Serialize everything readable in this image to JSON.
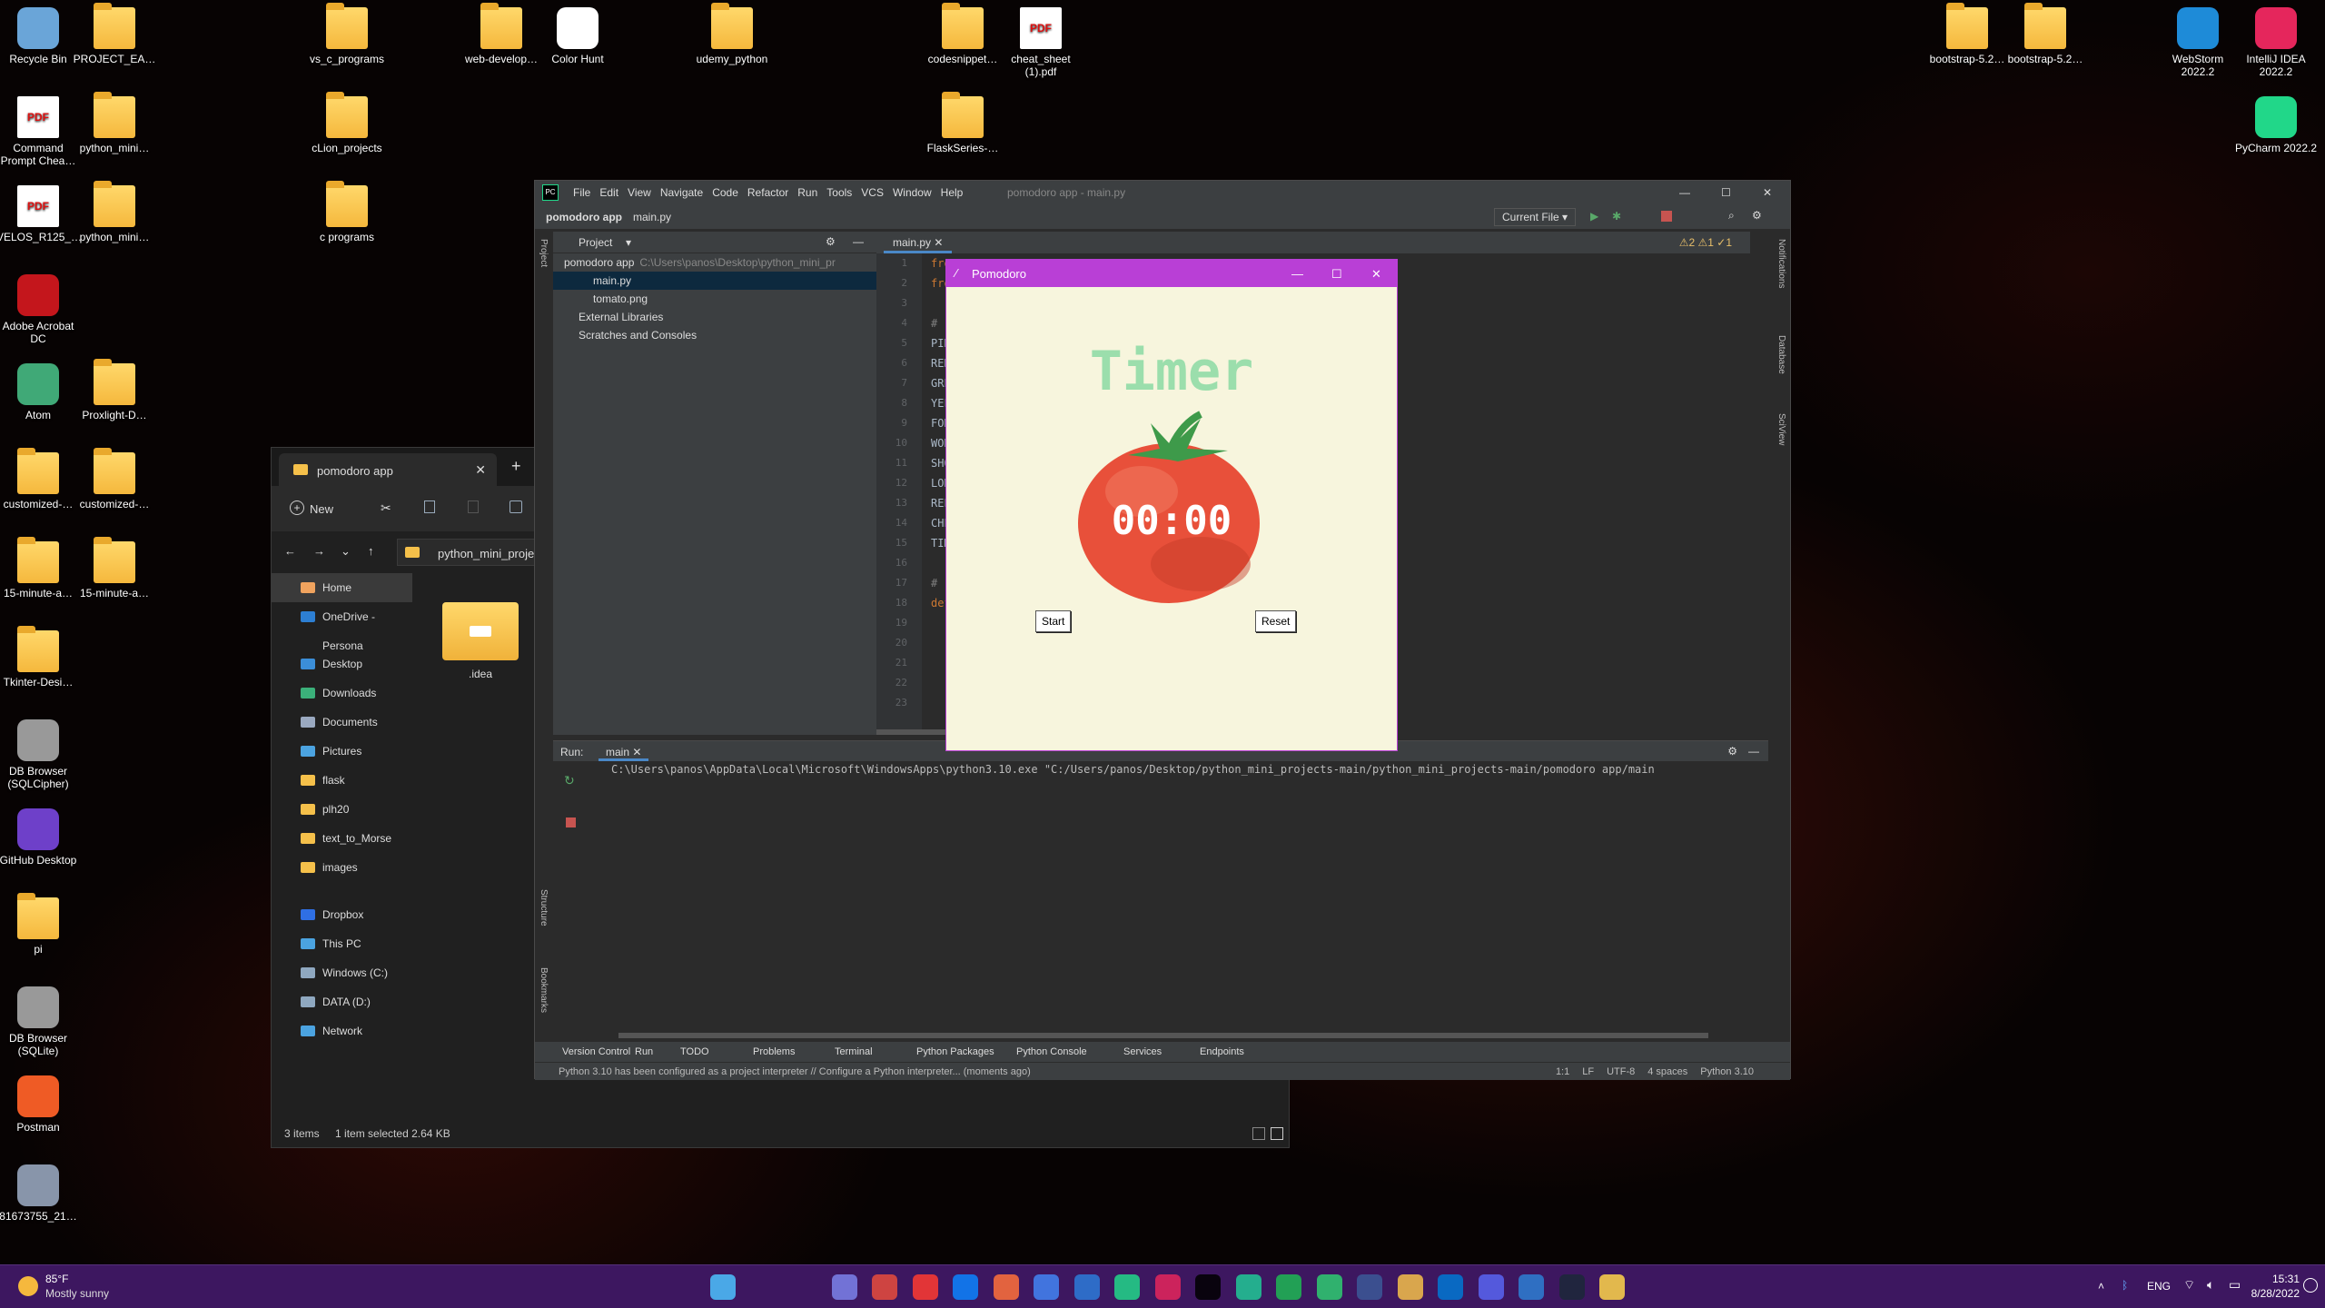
{
  "desktop": {
    "icons_left": [
      {
        "label": "Recycle Bin",
        "kind": "app",
        "color": "#6aa5d8"
      },
      {
        "label": "Command Prompt Chea…",
        "kind": "pdf"
      },
      {
        "label": "VELOS_R125_…",
        "kind": "pdf"
      },
      {
        "label": "Adobe Acrobat DC",
        "kind": "app",
        "color": "#c4161c"
      },
      {
        "label": "Atom",
        "kind": "app",
        "color": "#40a977"
      },
      {
        "label": "customized-…",
        "kind": "folder"
      },
      {
        "label": "15-minute-a…",
        "kind": "folder"
      },
      {
        "label": "Tkinter-Desi…",
        "kind": "folder"
      },
      {
        "label": "DB Browser (SQLCipher)",
        "kind": "app",
        "color": "#999"
      },
      {
        "label": "GitHub Desktop",
        "kind": "app",
        "color": "#6e40c9"
      },
      {
        "label": "pi",
        "kind": "folder"
      },
      {
        "label": "DB Browser (SQLite)",
        "kind": "app",
        "color": "#999"
      },
      {
        "label": "Postman",
        "kind": "app",
        "color": "#ef5b25"
      },
      {
        "label": "81673755_21…",
        "kind": "app",
        "color": "#8895aa"
      }
    ],
    "icons_col2": [
      {
        "label": "PROJECT_EA…",
        "kind": "folder"
      },
      {
        "label": "python_mini…",
        "kind": "folder"
      },
      {
        "label": "python_mini…",
        "kind": "folder"
      },
      {
        "label": "Proxlight-D…",
        "kind": "folder"
      },
      {
        "label": "customized-…",
        "kind": "folder"
      },
      {
        "label": "15-minute-a…",
        "kind": "folder"
      }
    ],
    "icons_top": [
      {
        "label": "vs_c_programs",
        "kind": "folder"
      },
      {
        "label": "web-develop…",
        "kind": "folder"
      },
      {
        "label": "Color Hunt",
        "kind": "app",
        "color": "#fff"
      },
      {
        "label": "udemy_python",
        "kind": "folder"
      },
      {
        "label": "codesnippet…",
        "kind": "folder"
      },
      {
        "label": "cheat_sheet (1).pdf",
        "kind": "pdf"
      },
      {
        "label": "cLion_projects",
        "kind": "folder"
      },
      {
        "label": "FlaskSeries-…",
        "kind": "folder"
      },
      {
        "label": "c programs",
        "kind": "folder"
      },
      {
        "label": "bootstrap-5.2…",
        "kind": "folder"
      },
      {
        "label": "bootstrap-5.2…",
        "kind": "folder"
      },
      {
        "label": "WebStorm 2022.2",
        "kind": "app",
        "color": "#1e8bd8"
      },
      {
        "label": "IntelliJ IDEA 2022.2",
        "kind": "app",
        "color": "#e5265c"
      },
      {
        "label": "PyCharm 2022.2",
        "kind": "app",
        "color": "#21d789"
      }
    ]
  },
  "explorer": {
    "tab_title": "pomodoro app",
    "close": "✕",
    "new_tab": "+",
    "new_label": "New",
    "address": "python_mini_project",
    "nav": [
      {
        "label": "Home",
        "color": "#f0a35e",
        "selected": true
      },
      {
        "label": "OneDrive - Persona",
        "color": "#2d7fd3"
      },
      {
        "label": "Desktop",
        "color": "#3b8ed8"
      },
      {
        "label": "Downloads",
        "color": "#3bb07a"
      },
      {
        "label": "Documents",
        "color": "#9aa9c0"
      },
      {
        "label": "Pictures",
        "color": "#4ba3e0"
      },
      {
        "label": "flask",
        "color": "#f5c04a"
      },
      {
        "label": "plh20",
        "color": "#f5c04a"
      },
      {
        "label": "text_to_Morse",
        "color": "#f5c04a"
      },
      {
        "label": "images",
        "color": "#f5c04a"
      },
      {
        "label": "Dropbox",
        "color": "#2f6fe4"
      },
      {
        "label": "This PC",
        "color": "#4ba3e0"
      },
      {
        "label": "Windows (C:)",
        "color": "#8fa8c0"
      },
      {
        "label": "DATA (D:)",
        "color": "#8fa8c0"
      },
      {
        "label": "Network",
        "color": "#4ba3e0"
      }
    ],
    "item_label": ".idea",
    "status_items": "3 items",
    "status_selected": "1 item selected  2.64 KB"
  },
  "pycharm": {
    "window_title": "pomodoro app - main.py",
    "menu": [
      "File",
      "Edit",
      "View",
      "Navigate",
      "Code",
      "Refactor",
      "Run",
      "Tools",
      "VCS",
      "Window",
      "Help"
    ],
    "breadcrumb_project": "pomodoro app",
    "breadcrumb_file": "main.py",
    "run_config": "Current File",
    "project_label": "Project",
    "tree": [
      {
        "label": "pomodoro app",
        "hint": "C:\\Users\\panos\\Desktop\\python_mini_pr",
        "indent": 0,
        "selected": false
      },
      {
        "label": "main.py",
        "indent": 2,
        "selected": true
      },
      {
        "label": "tomato.png",
        "indent": 2,
        "selected": false
      },
      {
        "label": "External Libraries",
        "indent": 1,
        "selected": false
      },
      {
        "label": "Scratches and Consoles",
        "indent": 1,
        "selected": false
      }
    ],
    "editor_tab": "main.py",
    "inspections": "⚠2 ⚠1 ✓1",
    "code_lines": [
      "fro",
      "fro",
      "",
      "# -",
      "PIN",
      "RED",
      "GRE",
      "YEL",
      "FON",
      "WOR",
      "SHO",
      "LON",
      "REP",
      "CHE",
      "TIM",
      "",
      "# -",
      "def",
      "",
      "",
      "",
      "",
      ""
    ],
    "run_label": "Run:",
    "run_tab": "main",
    "run_command": "C:\\Users\\panos\\AppData\\Local\\Microsoft\\WindowsApps\\python3.10.exe \"C:/Users/panos/Desktop/python_mini_projects-main/python_mini_projects-main/pomodoro app/main",
    "tool_windows": [
      "Version Control",
      "Run",
      "TODO",
      "Problems",
      "Terminal",
      "Python Packages",
      "Python Console",
      "Services",
      "Endpoints"
    ],
    "status_msg": "Python 3.10 has been configured as a project interpreter // Configure a Python interpreter... (moments ago)",
    "status_right": [
      "1:1",
      "LF",
      "UTF-8",
      "4 spaces",
      "Python 3.10"
    ],
    "side_left": [
      "Project",
      "Structure",
      "Bookmarks"
    ],
    "side_right": [
      "Notifications",
      "Database",
      "SciView"
    ]
  },
  "pomodoro": {
    "window_title": "Pomodoro",
    "heading": "Timer",
    "time": "00:00",
    "start": "Start",
    "reset": "Reset",
    "colors": {
      "bg": "#f7f5dd",
      "title_bar": "#b93fd6",
      "heading": "#9bdeac",
      "tomato": "#e8503a"
    }
  },
  "taskbar": {
    "weather_temp": "85°F",
    "weather_desc": "Mostly sunny",
    "lang": "ENG",
    "time": "15:31",
    "date": "8/28/2022"
  }
}
